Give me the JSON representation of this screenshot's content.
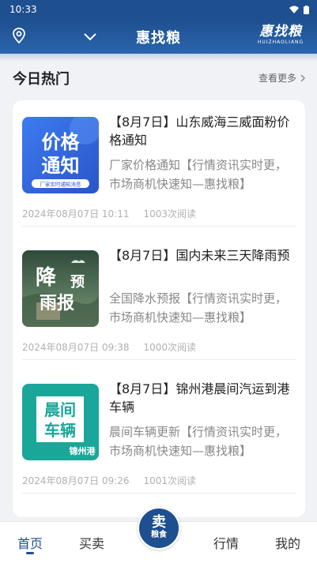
{
  "status_bar": {
    "time": "10:33"
  },
  "nav": {
    "title": "惠找粮",
    "logo_cn": "惠找粮",
    "logo_en": "HUIZHAOLIANG"
  },
  "section": {
    "title": "今日热门",
    "more_label": "查看更多"
  },
  "news": [
    {
      "title": "【8月7日】山东威海三威面粉价格通知",
      "desc": "厂家价格通知【行情资讯实时更，市场商机快速知—惠找粮】",
      "date": "2024年08月07日 10:11",
      "reads": "1003次阅读",
      "thumb": {
        "line1": "价格",
        "line2": "通知",
        "tag": "厂家实时通知消息"
      }
    },
    {
      "title": "【8月7日】国内未来三天降雨预",
      "desc": "全国降水预报【行情资讯实时更，市场商机快速知—惠找粮】",
      "date": "2024年08月07日 09:38",
      "reads": "1000次阅读",
      "thumb": {
        "line1": "降",
        "line2": "雨报",
        "side": "预"
      }
    },
    {
      "title": "【8月7日】锦州港晨间汽运到港车辆",
      "desc": "晨间车辆更新【行情资讯实时更，市场商机快速知—惠找粮】",
      "date": "2024年08月07日 09:26",
      "reads": "1001次阅读",
      "thumb": {
        "line1": "晨间",
        "line2": "车辆",
        "tag": "锦州港"
      }
    }
  ],
  "tabs": {
    "home": "首页",
    "buy": "买卖",
    "sell_big": "卖",
    "sell_small": "粮食",
    "market": "行情",
    "mine": "我的"
  },
  "colors": {
    "brand": "#1e4f8f",
    "accent_blue": "#3a6fe0",
    "teal": "#1aa79a"
  }
}
